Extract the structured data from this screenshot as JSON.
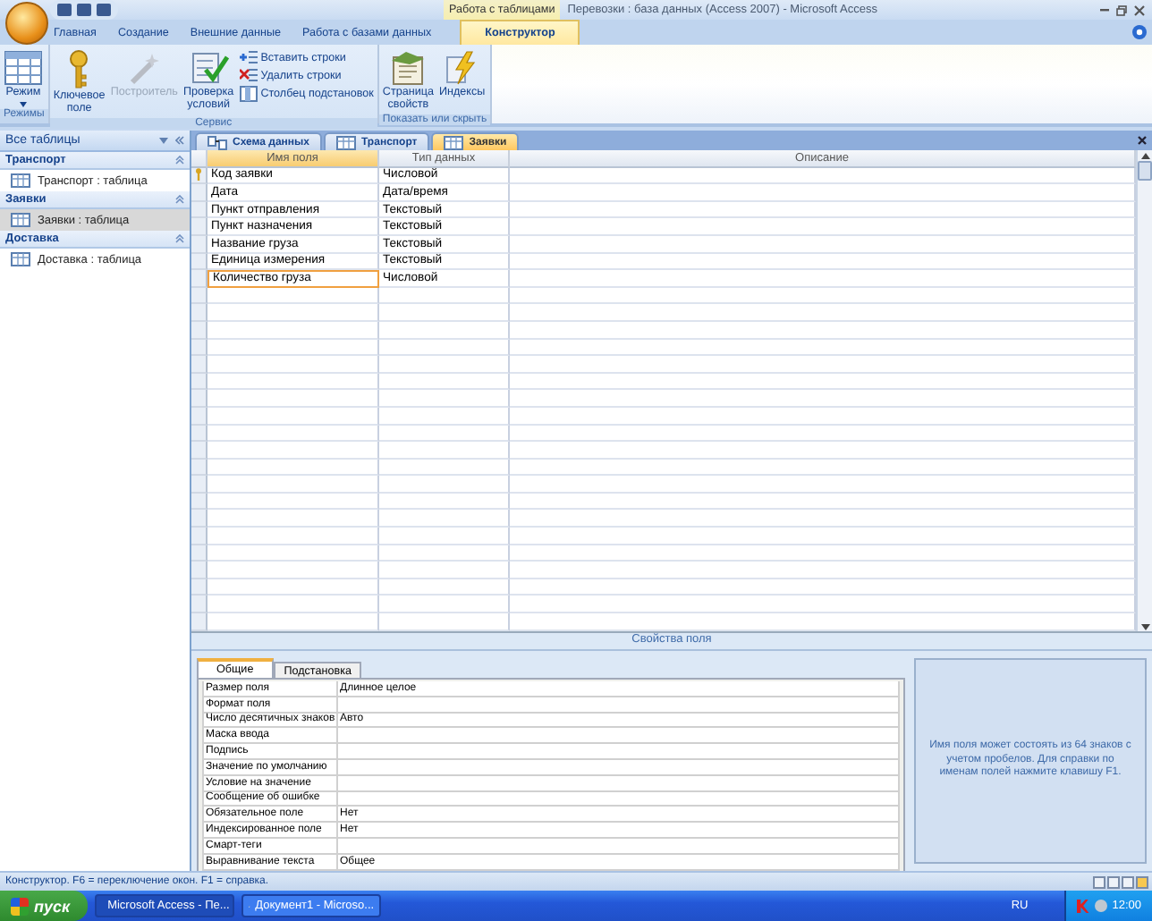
{
  "window": {
    "title": "Перевозки : база данных (Access 2007) - Microsoft Access",
    "context_group": "Работа с таблицами"
  },
  "ribbon_tabs": [
    {
      "label": "Главная",
      "selected": false
    },
    {
      "label": "Создание",
      "selected": false
    },
    {
      "label": "Внешние данные",
      "selected": false
    },
    {
      "label": "Работа с базами данных",
      "selected": false
    },
    {
      "label": "Конструктор",
      "selected": true
    }
  ],
  "ribbon_groups": [
    {
      "label": "Режимы",
      "buttons": [
        {
          "label": "Режим",
          "kind": "large",
          "disabled": false
        }
      ]
    },
    {
      "label": "Сервис",
      "buttons": [
        {
          "label": "Ключевое поле",
          "kind": "large",
          "disabled": false
        },
        {
          "label": "Построитель",
          "kind": "large",
          "disabled": true
        },
        {
          "label": "Проверка условий",
          "kind": "large",
          "disabled": false
        },
        {
          "label": "Вставить строки",
          "kind": "small",
          "disabled": false
        },
        {
          "label": "Удалить строки",
          "kind": "small",
          "disabled": false
        },
        {
          "label": "Столбец подстановок",
          "kind": "small",
          "disabled": false
        }
      ]
    },
    {
      "label": "Показать или скрыть",
      "buttons": [
        {
          "label": "Страница свойств",
          "kind": "large",
          "disabled": false
        },
        {
          "label": "Индексы",
          "kind": "large",
          "disabled": false
        }
      ]
    }
  ],
  "nav": {
    "header": "Все таблицы",
    "groups": [
      {
        "title": "Транспорт",
        "items": [
          {
            "label": "Транспорт : таблица",
            "selected": false
          }
        ]
      },
      {
        "title": "Заявки",
        "items": [
          {
            "label": "Заявки : таблица",
            "selected": true
          }
        ]
      },
      {
        "title": "Доставка",
        "items": [
          {
            "label": "Доставка : таблица",
            "selected": false
          }
        ]
      }
    ]
  },
  "doc_tabs": [
    {
      "label": "Схема данных",
      "kind": "diagram",
      "selected": false
    },
    {
      "label": "Транспорт",
      "kind": "table",
      "selected": false
    },
    {
      "label": "Заявки",
      "kind": "table",
      "selected": true
    }
  ],
  "design_grid": {
    "columns": [
      "Имя поля",
      "Тип данных",
      "Описание"
    ],
    "rows": [
      {
        "name": "Код заявки",
        "type": "Числовой",
        "primary_key": true,
        "selected": false
      },
      {
        "name": "Дата",
        "type": "Дата/время",
        "primary_key": false,
        "selected": false
      },
      {
        "name": "Пункт отправления",
        "type": "Текстовый",
        "primary_key": false,
        "selected": false
      },
      {
        "name": "Пункт назначения",
        "type": "Текстовый",
        "primary_key": false,
        "selected": false
      },
      {
        "name": "Название груза",
        "type": "Текстовый",
        "primary_key": false,
        "selected": false
      },
      {
        "name": "Единица измерения",
        "type": "Текстовый",
        "primary_key": false,
        "selected": false
      },
      {
        "name": "Количество груза",
        "type": "Числовой",
        "primary_key": false,
        "selected": true
      }
    ]
  },
  "properties": {
    "title": "Свойства поля",
    "tabs": [
      {
        "label": "Общие",
        "selected": true
      },
      {
        "label": "Подстановка",
        "selected": false
      }
    ],
    "rows": [
      {
        "label": "Размер поля",
        "value": "Длинное целое"
      },
      {
        "label": "Формат поля"
      },
      {
        "label": "Число десятичных знаков",
        "value": "Авто"
      },
      {
        "label": "Маска ввода"
      },
      {
        "label": "Подпись"
      },
      {
        "label": "Значение по умолчанию"
      },
      {
        "label": "Условие на значение"
      },
      {
        "label": "Сообщение об ошибке"
      },
      {
        "label": "Обязательное поле",
        "value": "Нет"
      },
      {
        "label": "Индексированное поле",
        "value": "Нет"
      },
      {
        "label": "Смарт-теги"
      },
      {
        "label": "Выравнивание текста",
        "value": "Общее"
      }
    ],
    "help": "Имя поля может состоять из 64 знаков с учетом пробелов.  Для справки по именам полей нажмите клавишу F1."
  },
  "status_bar": "Конструктор.  F6 = переключение окон.  F1 = справка.",
  "taskbar": {
    "start": "пуск",
    "tasks": [
      {
        "label": "Microsoft Access - Пе...",
        "selected": true
      },
      {
        "label": "Документ1 - Microso...",
        "selected": false
      }
    ],
    "language": "RU",
    "clock": "12:00"
  }
}
